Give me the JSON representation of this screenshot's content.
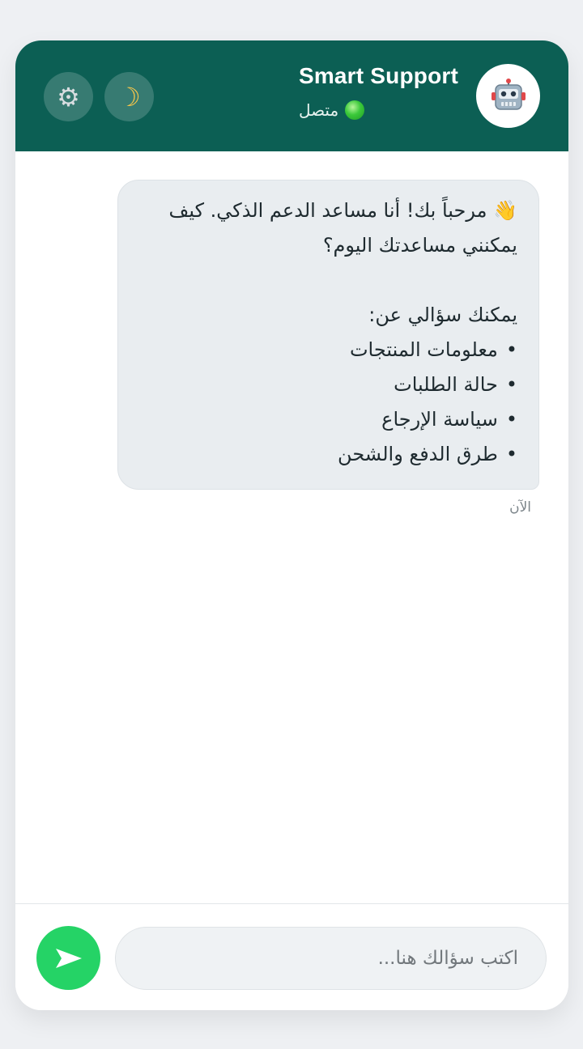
{
  "header": {
    "title": "Smart Support",
    "status": "متصل",
    "colors": {
      "header_bg": "#0c5f54",
      "online": "#3bc93a"
    },
    "icons": {
      "settings": "gear-icon",
      "theme": "moon-icon",
      "avatar": "robot-icon",
      "status": "online-dot-icon"
    }
  },
  "messages": [
    {
      "sender": "bot",
      "lines": [
        "👋 مرحباً بك! أنا مساعد الدعم الذكي. كيف",
        "يمكنني مساعدتك اليوم؟",
        "",
        "يمكنك سؤالي عن:"
      ],
      "bullets": [
        "معلومات المنتجات",
        "حالة الطلبات",
        "سياسة الإرجاع",
        "طرق الدفع والشحن"
      ],
      "time": "الآن"
    }
  ],
  "composer": {
    "placeholder": "اكتب سؤالك هنا...",
    "value": "",
    "send_icon": "send-icon",
    "send_color": "#25d366"
  }
}
